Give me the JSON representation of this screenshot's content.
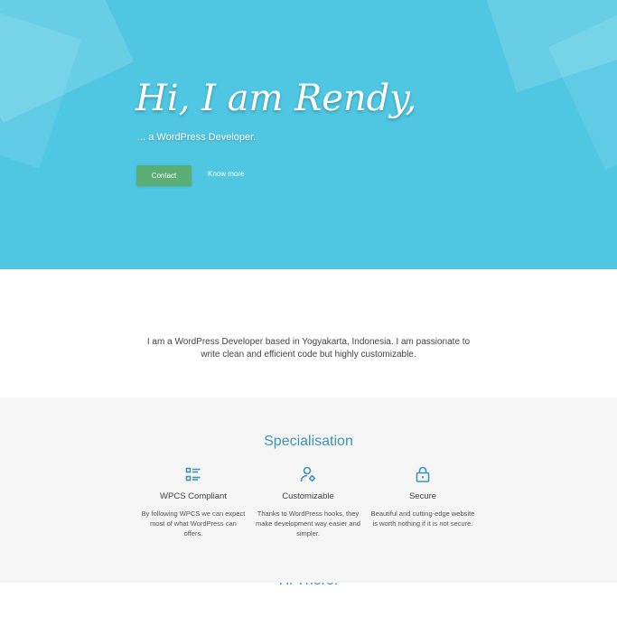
{
  "hero": {
    "title": "Hi, I am Rendy,",
    "subtitle": "... a WordPress Developer.",
    "contact_label": "Contact",
    "more_label": "Know more"
  },
  "intro": {
    "title": "Hi There!",
    "text": "I am a WordPress Developer based in Yogyakarta, Indonesia. I am passionate to write clean and efficient code but highly customizable."
  },
  "specialisation": {
    "title": "Specialisation",
    "features": [
      {
        "icon": "list-icon",
        "title": "WPCS Compliant",
        "text": "By following WPCS we can expect most of what WordPress can offers."
      },
      {
        "icon": "user-gear-icon",
        "title": "Customizable",
        "text": "Thanks to WordPress hooks, they make development way easier and simpler."
      },
      {
        "icon": "lock-icon",
        "title": "Secure",
        "text": "Beautiful and cutting-edge website is worth nothing if it is not secure."
      }
    ]
  },
  "colors": {
    "hero_bg": "#4fc6e2",
    "accent": "#3d94b3",
    "button": "#5aad75",
    "section_bg": "#f5f5f5"
  }
}
